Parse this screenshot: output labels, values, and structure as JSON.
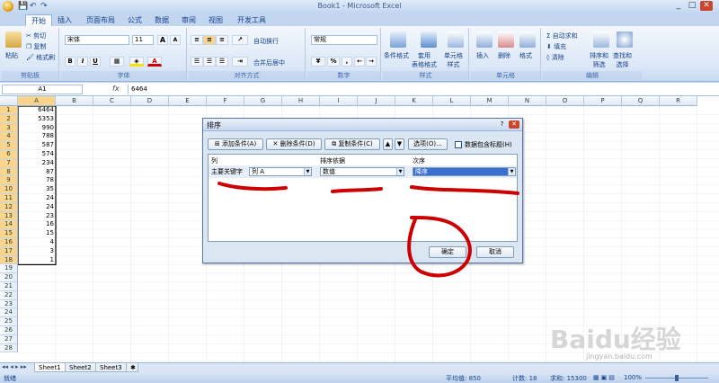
{
  "window": {
    "title": "Book1 - Microsoft Excel",
    "minimize": "_",
    "maximize": "□",
    "close": "✕"
  },
  "tabs": [
    "开始",
    "插入",
    "页面布局",
    "公式",
    "数据",
    "审阅",
    "视图",
    "开发工具"
  ],
  "ribbon": {
    "clipboard": {
      "paste": "粘贴",
      "cut": "剪切",
      "copy": "复制",
      "format_painter": "格式刷",
      "label": "剪贴板"
    },
    "font": {
      "name": "宋体",
      "size": "11",
      "grow": "A",
      "shrink": "A",
      "bold": "B",
      "italic": "I",
      "underline": "U",
      "label": "字体"
    },
    "alignment": {
      "wrap": "自动换行",
      "merge": "合并后居中",
      "label": "对齐方式"
    },
    "number": {
      "format": "常规",
      "percent": "%",
      "comma": ",",
      "label": "数字"
    },
    "styles": {
      "conditional": "条件格式",
      "table": "套用\n表格格式",
      "cell_styles": "单元格\n样式",
      "label": "样式"
    },
    "cells": {
      "insert": "插入",
      "delete": "删除",
      "format": "格式",
      "label": "单元格"
    },
    "editing": {
      "autosum": "自动求和",
      "fill": "填充",
      "clear": "清除",
      "sort": "排序和\n筛选",
      "find": "查找和\n选择",
      "label": "编辑"
    }
  },
  "formula_bar": {
    "name_box": "A1",
    "fx": "fx",
    "value": "6464"
  },
  "grid": {
    "columns": [
      "A",
      "B",
      "C",
      "D",
      "E",
      "F",
      "G",
      "H",
      "I",
      "J",
      "K",
      "L",
      "M",
      "N",
      "O",
      "P",
      "Q",
      "R"
    ],
    "rows": [
      "1",
      "2",
      "3",
      "4",
      "5",
      "6",
      "7",
      "8",
      "9",
      "10",
      "11",
      "12",
      "13",
      "14",
      "15",
      "16",
      "17",
      "18",
      "19",
      "20",
      "21",
      "22",
      "23",
      "24",
      "25",
      "26",
      "27",
      "28"
    ],
    "column_a_values": [
      "6464",
      "5353",
      "990",
      "788",
      "587",
      "574",
      "234",
      "87",
      "78",
      "35",
      "24",
      "24",
      "23",
      "16",
      "15",
      "4",
      "3",
      "1"
    ]
  },
  "sheets": [
    "Sheet1",
    "Sheet2",
    "Sheet3"
  ],
  "status": {
    "ready": "就绪",
    "average": "平均值: 850",
    "count": "计数: 18",
    "sum": "求和: 15300",
    "zoom": "100%"
  },
  "sort_dialog": {
    "title": "排序",
    "add_level": "添加条件(A)",
    "delete_level": "删除条件(D)",
    "copy_level": "复制条件(C)",
    "options": "选项(O)...",
    "has_headers": "数据包含标题(H)",
    "col_header": "列",
    "sort_on_header": "排序依据",
    "order_header": "次序",
    "row_label": "主要关键字",
    "column_value": "列 A",
    "sort_on_value": "数值",
    "order_value": "降序",
    "ok": "确定",
    "cancel": "取消"
  },
  "watermark": "Baidu经验",
  "watermark_url": "jingyan.baidu.com",
  "colors": {
    "annotation": "#cc0000",
    "selected_header": "#fbd58b"
  }
}
